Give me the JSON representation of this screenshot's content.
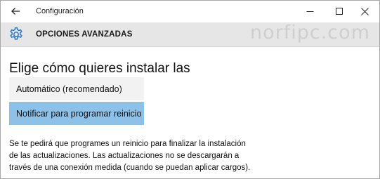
{
  "window": {
    "title": "Configuración",
    "controls": {
      "back": "back-arrow-icon",
      "minimize": "minimize-icon",
      "maximize": "maximize-icon",
      "close": "close-icon"
    }
  },
  "header": {
    "icon": "gear-icon",
    "title": "OPCIONES AVANZADAS",
    "watermark": "norfipc.com"
  },
  "main": {
    "heading": "Elige cómo quieres instalar las",
    "options": [
      {
        "label": "Automático (recomendado)",
        "selected": false
      },
      {
        "label": "Notificar para programar reinicio",
        "selected": true
      }
    ],
    "description_lines": [
      "Se te pedirá que programes un reinicio para finalizar la instalación",
      "de las actualizaciones. Las actualizaciones no se descargarán a",
      "través de una conexión medida (cuando se puedan aplicar cargos)."
    ]
  },
  "colors": {
    "header_bg": "#e6e6e6",
    "selected_option": "#8ec1e8",
    "unselected_option": "#f2f2f2",
    "gear_accent": "#2a78c2"
  }
}
